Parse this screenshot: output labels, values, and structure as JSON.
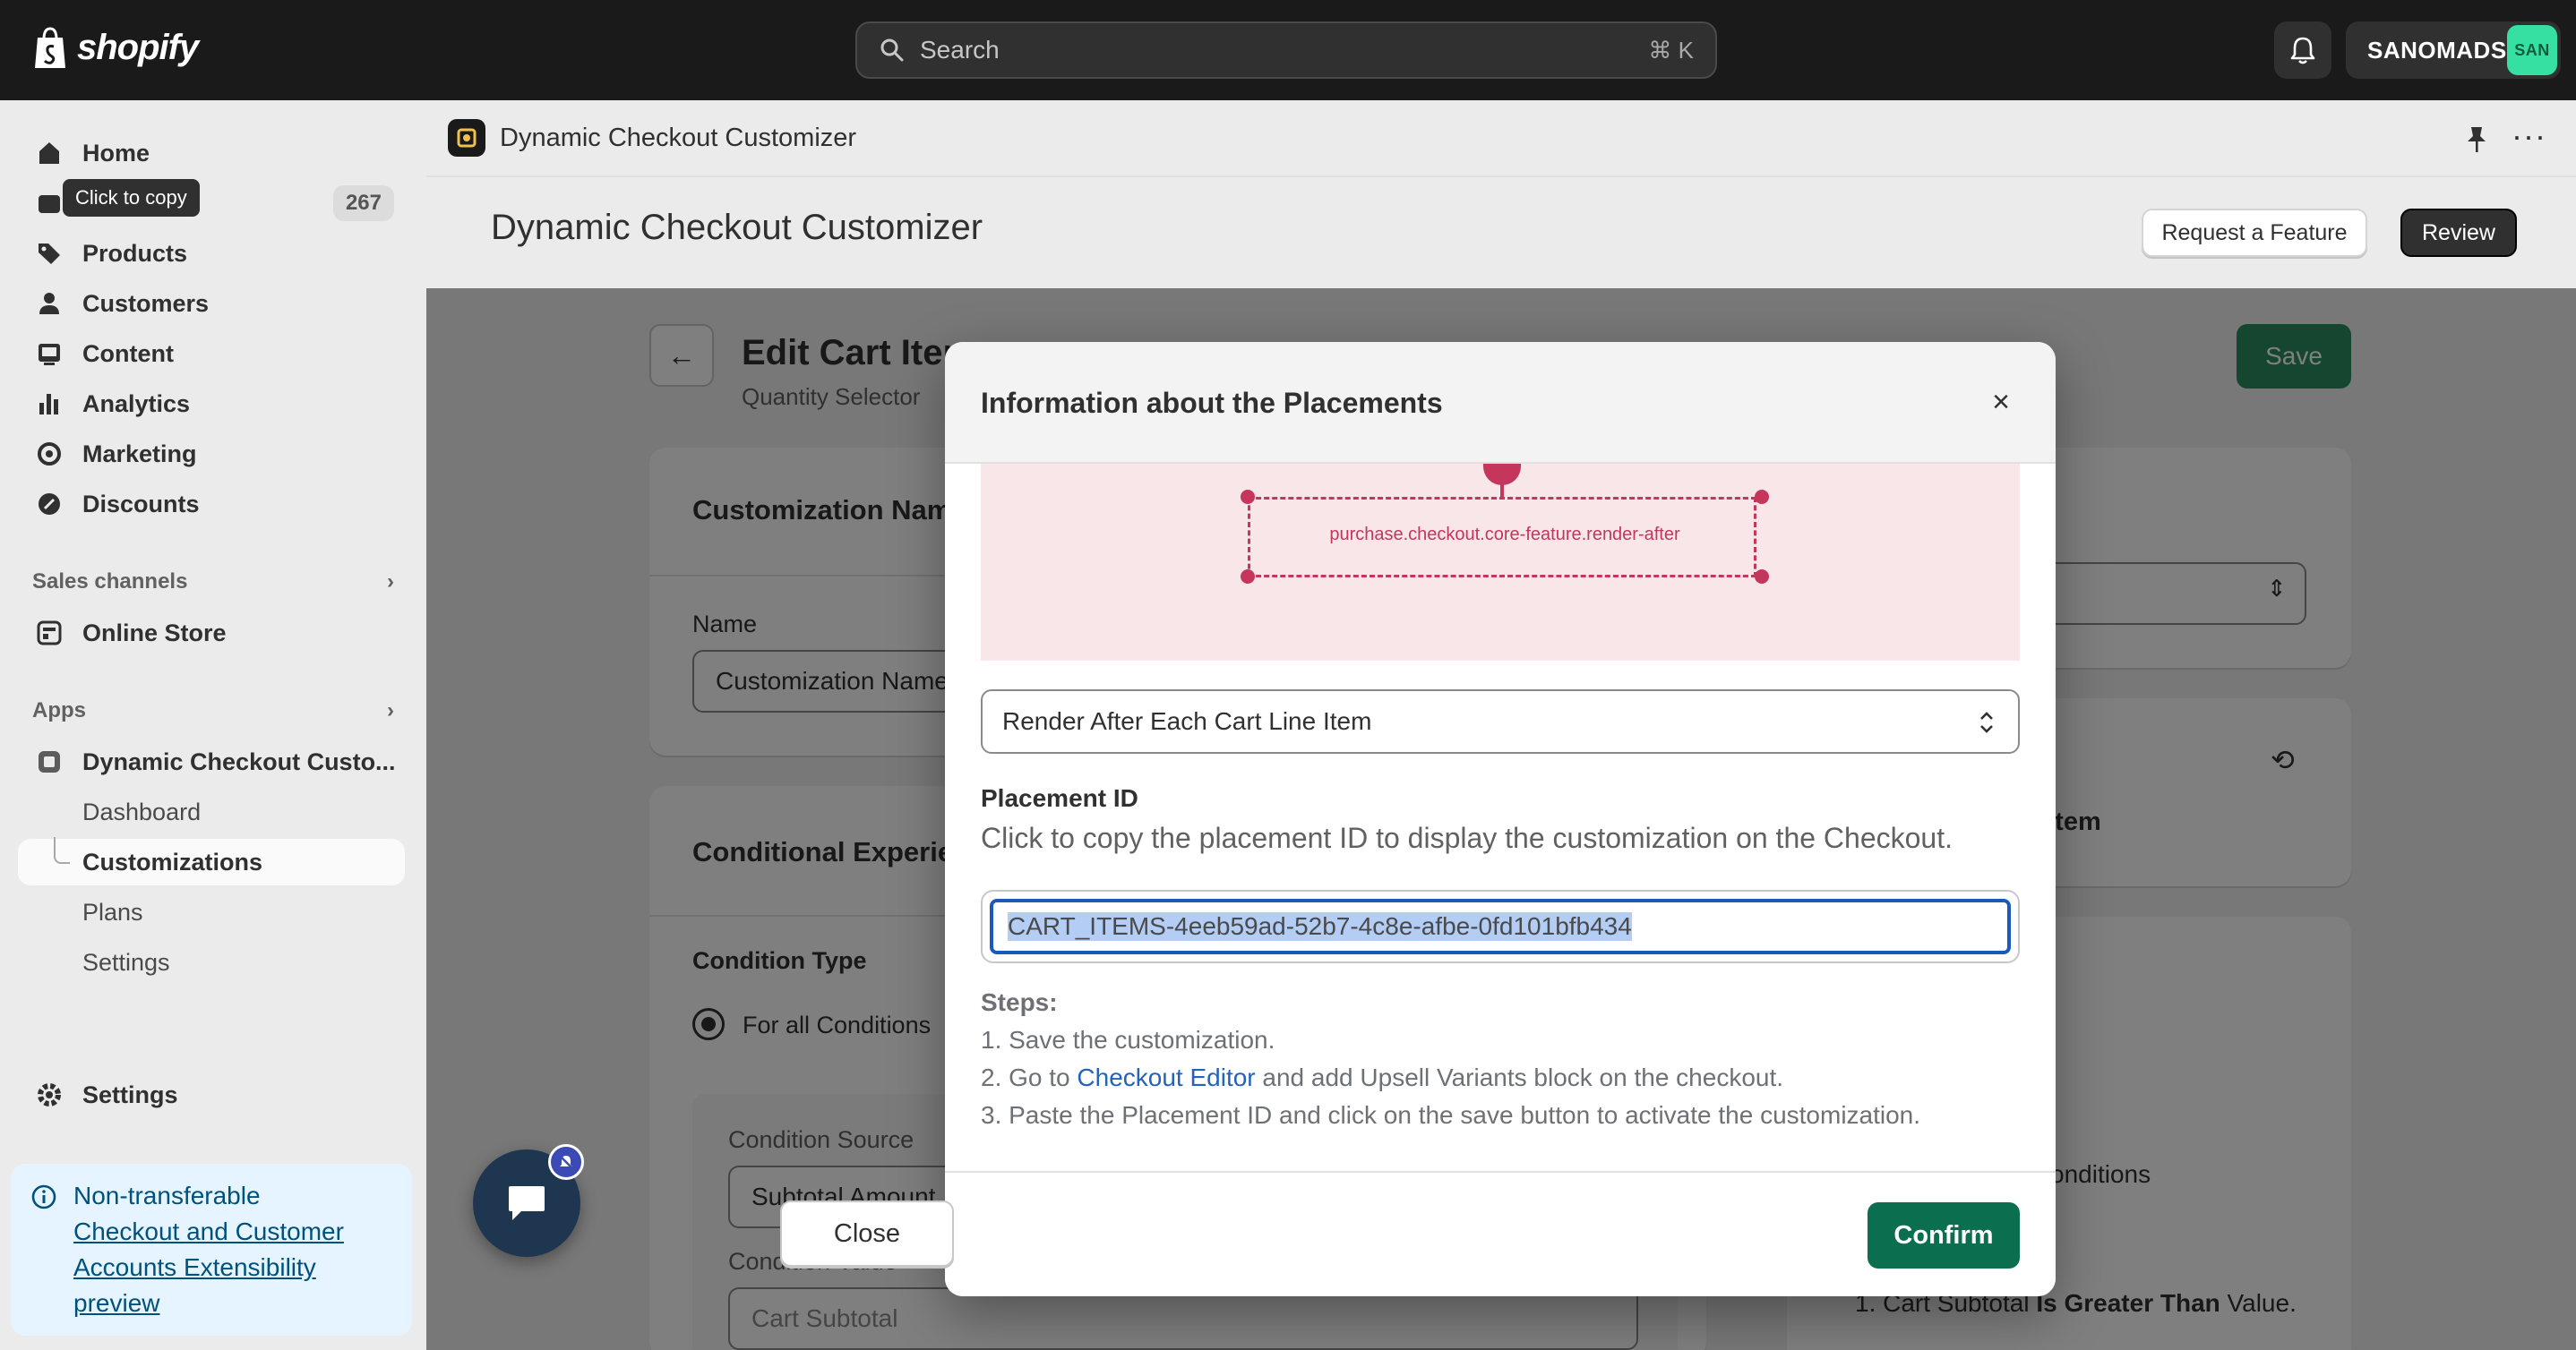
{
  "topbar": {
    "brand": "shopify",
    "search_placeholder": "Search",
    "search_shortcut": "⌘ K",
    "store_name": "SANOMADS",
    "store_avatar": "SAN"
  },
  "sidebar": {
    "tooltip": "Click to copy",
    "items": [
      {
        "label": "Home",
        "icon": "home-icon"
      },
      {
        "label": "",
        "icon": "orders-icon",
        "badge": "267"
      },
      {
        "label": "Products",
        "icon": "tag-icon"
      },
      {
        "label": "Customers",
        "icon": "person-icon"
      },
      {
        "label": "Content",
        "icon": "image-icon"
      },
      {
        "label": "Analytics",
        "icon": "bar-chart-icon"
      },
      {
        "label": "Marketing",
        "icon": "target-icon"
      },
      {
        "label": "Discounts",
        "icon": "discount-icon"
      }
    ],
    "sales_channels_heading": "Sales channels",
    "online_store": "Online Store",
    "apps_heading": "Apps",
    "app_name": "Dynamic Checkout Custo...",
    "app_sub_items": [
      "Dashboard",
      "Customizations",
      "Plans",
      "Settings"
    ],
    "active_sub_item": "Customizations",
    "settings": "Settings",
    "notice": {
      "title": "Non-transferable",
      "link": "Checkout and Customer Accounts Extensibility preview"
    }
  },
  "app_header": {
    "title": "Dynamic Checkout Customizer"
  },
  "page": {
    "title": "Dynamic Checkout Customizer",
    "request_feature": "Request a Feature",
    "review": "Review"
  },
  "background": {
    "edit_title": "Edit Cart Item",
    "edit_subtitle": "Quantity Selector",
    "save": "Save",
    "customization_name_heading": "Customization Name",
    "name_label": "Name",
    "name_value": "Customization Name",
    "conditional_heading": "Conditional Experience",
    "condition_type_label": "Condition Type",
    "condition_type_value": "For all Conditions",
    "condition_source_label": "Condition Source",
    "condition_source_value": "Subtotal Amount",
    "condition_value_label": "Condition Value",
    "condition_value_value": "Cart Subtotal",
    "placement_summary": "Each Cart Line Item",
    "conditions_text": "conditions",
    "rule_text_prefix": "1. Cart Subtotal ",
    "rule_text_bold": "Is Greater Than",
    "rule_text_suffix": " Value."
  },
  "modal": {
    "title": "Information about the Placements",
    "diagram_label": "purchase.checkout.core-feature.render-after",
    "select_value": "Render After Each Cart Line Item",
    "placement_id_label": "Placement ID",
    "help_text": "Click to copy the placement ID to display the customization on the Checkout.",
    "placement_id": "CART_ITEMS-4eeb59ad-52b7-4c8e-afbe-0fd101bfb434",
    "steps_heading": "Steps:",
    "step1": "1. Save the customization.",
    "step2_prefix": "2. Go to ",
    "step2_link": "Checkout Editor",
    "step2_suffix": " and add Upsell Variants block on the checkout.",
    "step3": "3. Paste the Placement ID and click on the save button to activate the customization.",
    "close": "Close",
    "confirm": "Confirm"
  },
  "colors": {
    "topbar_bg": "#1a1a1a",
    "primary_green": "#0b6e4f",
    "link_blue": "#2463bc",
    "diagram_pink": "#c4365b",
    "notice_bg": "#e5f4fe"
  }
}
